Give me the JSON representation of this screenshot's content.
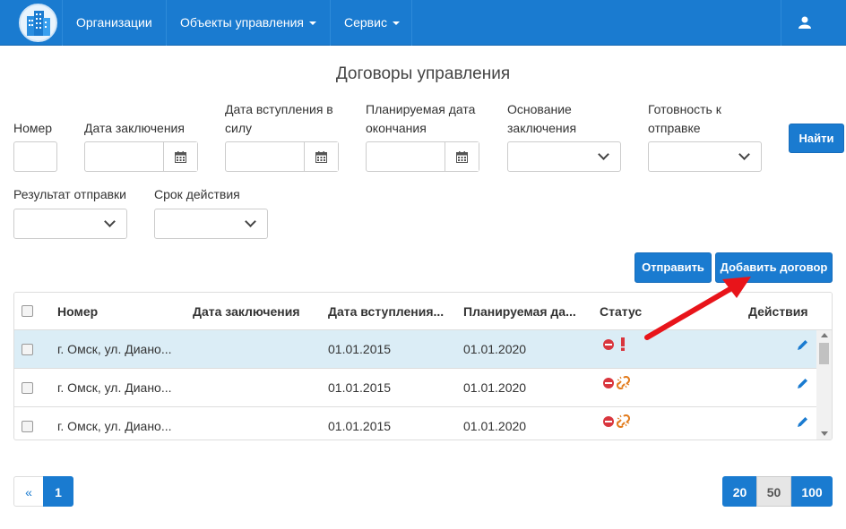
{
  "nav": {
    "items": [
      {
        "label": "Организации"
      },
      {
        "label": "Объекты управления"
      },
      {
        "label": "Сервис"
      }
    ]
  },
  "page_title": "Договоры управления",
  "filters": {
    "number": "Номер",
    "conclusion_date": "Дата заключения",
    "effective_date_line1": "Дата вступления в",
    "effective_date_line2": "силу",
    "planned_end_line1": "Планируемая дата",
    "planned_end_line2": "окончания",
    "basis_line1": "Основание",
    "basis_line2": "заключения",
    "readiness_line1": "Готовность к",
    "readiness_line2": "отправке",
    "send_result": "Результат отправки",
    "validity": "Срок действия"
  },
  "buttons": {
    "find": "Найти",
    "send": "Отправить",
    "add": "Добавить договор"
  },
  "table": {
    "headers": {
      "number": "Номер",
      "conclusion_date": "Дата заключения",
      "effective_date": "Дата вступления...",
      "planned_end": "Планируемая да...",
      "status": "Статус",
      "actions": "Действия"
    },
    "rows": [
      {
        "number": "г. Омск, ул. Диано...",
        "conclusion_date": "",
        "effective_date": "01.01.2015",
        "planned_end": "01.01.2020",
        "status_icons": [
          "stop-icon",
          "warning-exclamation-icon"
        ]
      },
      {
        "number": "г. Омск, ул. Диано...",
        "conclusion_date": "",
        "effective_date": "01.01.2015",
        "planned_end": "01.01.2020",
        "status_icons": [
          "stop-icon",
          "broken-link-icon"
        ]
      },
      {
        "number": "г. Омск, ул. Диано...",
        "conclusion_date": "",
        "effective_date": "01.01.2015",
        "planned_end": "01.01.2020",
        "status_icons": [
          "stop-icon",
          "broken-link-icon"
        ]
      }
    ]
  },
  "pagination": {
    "prev": "«",
    "pages": [
      "1"
    ],
    "page_sizes": [
      "20",
      "50",
      "100"
    ]
  },
  "colors": {
    "primary": "#1a7bd0",
    "highlight_row": "#dbedf6",
    "annotation_arrow": "#e8141a"
  }
}
